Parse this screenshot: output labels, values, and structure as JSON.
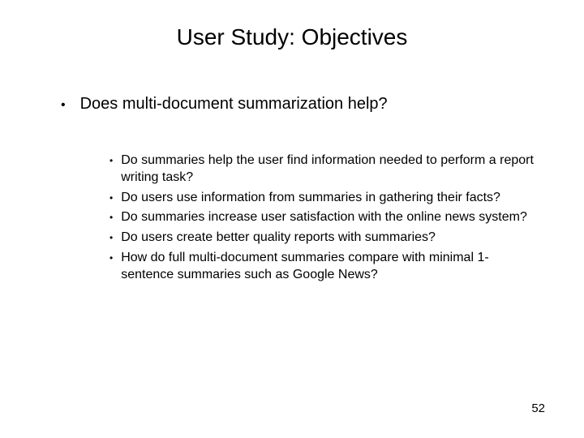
{
  "title": "User Study: Objectives",
  "main_bullet": {
    "text": "Does multi-document summarization help?"
  },
  "sub_bullets": [
    "Do summaries help the user find information needed to perform a report writing task?",
    "Do users use information from summaries in gathering their facts?",
    "Do summaries increase user satisfaction with the online news system?",
    "Do users create better quality reports with summaries?",
    "How do full multi-document summaries compare with minimal 1-sentence summaries such as Google News?"
  ],
  "page_number": "52"
}
